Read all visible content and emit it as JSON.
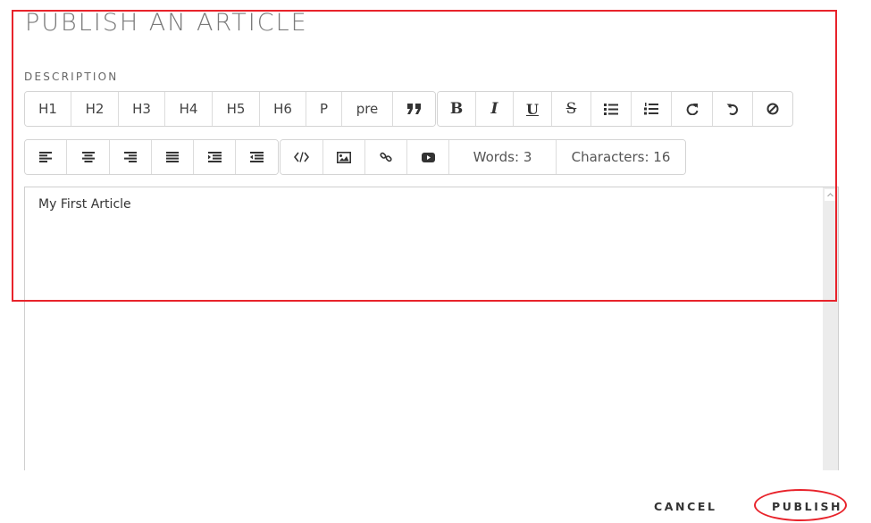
{
  "page": {
    "title": "PUBLISH AN ARTICLE"
  },
  "form": {
    "description_label": "DESCRIPTION"
  },
  "toolbar": {
    "headings": [
      "H1",
      "H2",
      "H3",
      "H4",
      "H5",
      "H6",
      "P",
      "pre"
    ],
    "quote_icon": "quote-icon",
    "format_icons": [
      "bold-icon",
      "italic-icon",
      "underline-icon",
      "strikethrough-icon",
      "bulleted-list-icon",
      "numbered-list-icon",
      "redo-icon",
      "undo-icon",
      "clear-format-icon"
    ],
    "align_icons": [
      "align-left-icon",
      "align-center-icon",
      "align-right-icon",
      "align-justify-icon",
      "indent-icon",
      "outdent-icon"
    ],
    "insert_icons": [
      "code-icon",
      "image-icon",
      "link-icon",
      "video-icon"
    ],
    "words_label": "Words: 3",
    "characters_label": "Characters: 16"
  },
  "editor": {
    "content": "My First Article"
  },
  "actions": {
    "cancel_label": "CANCEL",
    "publish_label": "PUBLISH"
  },
  "colors": {
    "annotation": "#e8232b",
    "border": "#d4d4d4",
    "text": "#555555"
  }
}
